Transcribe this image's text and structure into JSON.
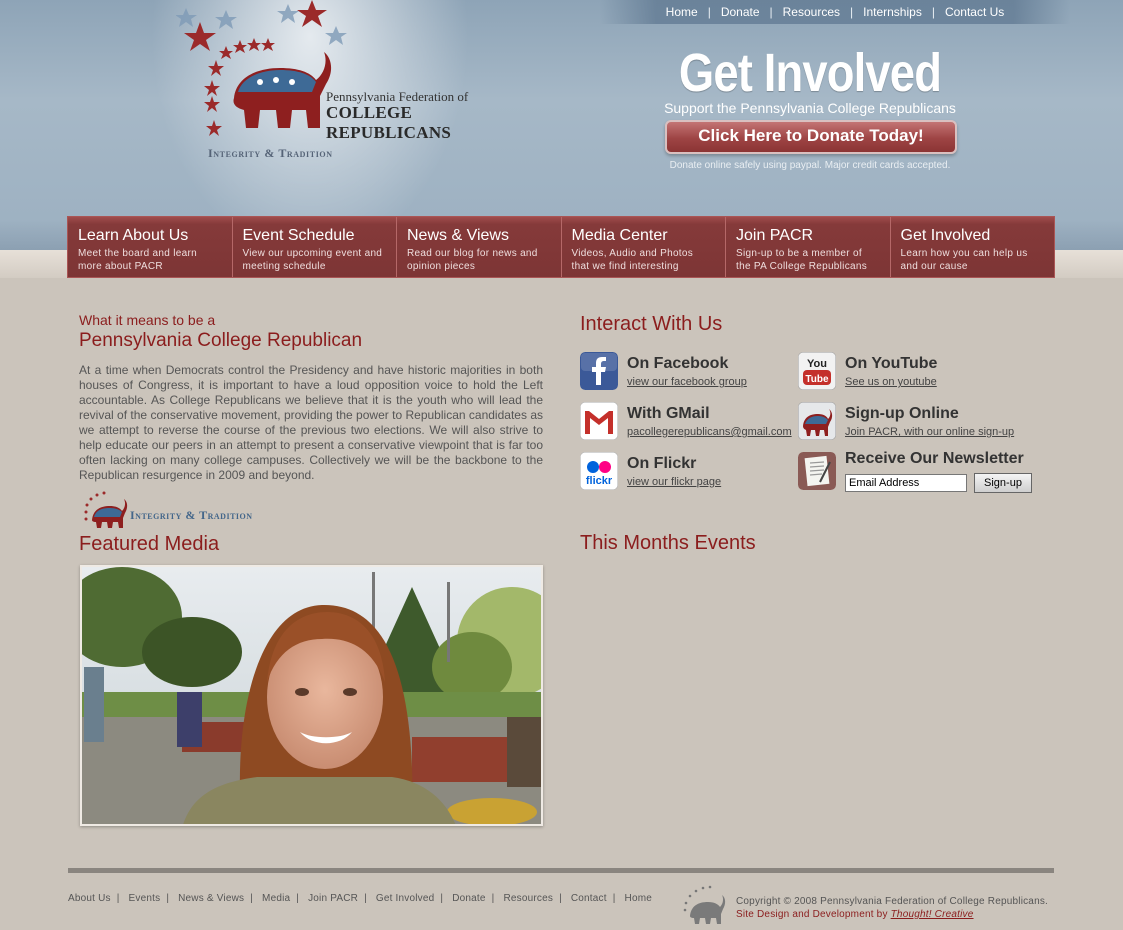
{
  "top_nav": [
    "Home",
    "Donate",
    "Resources",
    "Internships",
    "Contact Us"
  ],
  "logo": {
    "line1": "Pennsylvania Federation of",
    "line2": "COLLEGE REPUBLICANS",
    "tagline": "Integrity & Tradition"
  },
  "get_involved": {
    "title": "Get Involved",
    "subtitle": "Support the Pennsylvania College Republicans",
    "button": "Click Here to Donate Today!",
    "note": "Donate online safely using paypal. Major credit cards accepted."
  },
  "main_nav": [
    {
      "title": "Learn About Us",
      "desc1": "Meet the board and learn",
      "desc2": "more about PACR"
    },
    {
      "title": "Event Schedule",
      "desc1": "View our upcoming event and",
      "desc2": "meeting schedule"
    },
    {
      "title": "News & Views",
      "desc1": "Read our blog for news and",
      "desc2": "opinion pieces"
    },
    {
      "title": "Media Center",
      "desc1": "Videos, Audio and Photos",
      "desc2": "that we find interesting"
    },
    {
      "title": "Join PACR",
      "desc1": "Sign-up to be a member of",
      "desc2": "the PA College Republicans"
    },
    {
      "title": "Get Involved",
      "desc1": "Learn how you can help us",
      "desc2": "and our cause"
    }
  ],
  "about": {
    "pre_title": "What it means to be a",
    "title": "Pennsylvania College Republican",
    "body": "At a time when Democrats control the Presidency and have historic majorities in both houses of Congress, it is important to have a loud opposition voice to hold the Left accountable. As College Republicans we believe that it is the youth who will lead the revival of the conservative movement, providing the power to Republican candidates as we attempt to reverse the course of the previous two elections. We will also strive to help educate our peers in an attempt to present a conservative viewpoint that is far too often lacking on many college campuses. Collectively we will be the backbone to the Republican resurgence in 2009 and beyond.",
    "small_tagline": "Integrity & Tradition"
  },
  "featured_media": {
    "title": "Featured Media"
  },
  "interact": {
    "title": "Interact With Us",
    "facebook": {
      "name": "On Facebook",
      "link": "view our facebook group",
      "icon": "facebook-icon"
    },
    "youtube": {
      "name": "On YouTube",
      "link": "See us on youtube",
      "icon": "youtube-icon"
    },
    "gmail": {
      "name": "With GMail",
      "link": "pacollegerepublicans@gmail.com",
      "icon": "gmail-icon"
    },
    "signup": {
      "name": "Sign-up Online",
      "link": "Join PACR, with our online sign-up",
      "icon": "elephant-icon"
    },
    "flickr": {
      "name": "On Flickr",
      "link": "view our flickr page",
      "icon": "flickr-icon"
    },
    "newsletter": {
      "name": "Receive Our Newsletter",
      "input_value": "Email Address",
      "button": "Sign-up",
      "icon": "newsletter-icon"
    }
  },
  "events": {
    "title": "This Months Events"
  },
  "footer": {
    "links": [
      "About Us",
      "Events",
      "News & Views",
      "Media",
      "Join PACR",
      "Get Involved",
      "Donate",
      "Resources",
      "Contact",
      "Home"
    ],
    "copyright": "Copyright © 2008 Pennsylvania Federation of College Republicans.",
    "credit_prefix": "Site Design and Development by ",
    "credit_link": "Thought! Creative"
  },
  "colors": {
    "accent": "#8b1d1d",
    "nav": "#7d3535",
    "header": "#9cb0c1",
    "background": "#cbc4bb"
  }
}
